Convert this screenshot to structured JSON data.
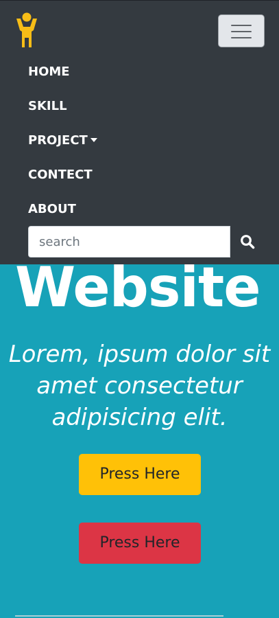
{
  "navbar": {
    "logo_icon": "person-arms-up-icon",
    "logo_color": "#f7bd17",
    "background": "#343a40",
    "toggler_icon": "hamburger-menu-icon",
    "links": [
      {
        "label": "HOME"
      },
      {
        "label": "SKILL"
      },
      {
        "label": "PROJECT",
        "has_dropdown": true
      },
      {
        "label": "CONTECT"
      },
      {
        "label": "ABOUT"
      }
    ],
    "search": {
      "placeholder": "search",
      "value": "",
      "button_icon": "search-icon"
    }
  },
  "hero": {
    "background": "#17a2b8",
    "title": "Website",
    "subtitle": "Lorem, ipsum dolor sit amet consectetur adipisicing elit.",
    "buttons": [
      {
        "label": "Press Here",
        "color": "#ffc107"
      },
      {
        "label": "Press Here",
        "color": "#dc3545"
      }
    ]
  }
}
